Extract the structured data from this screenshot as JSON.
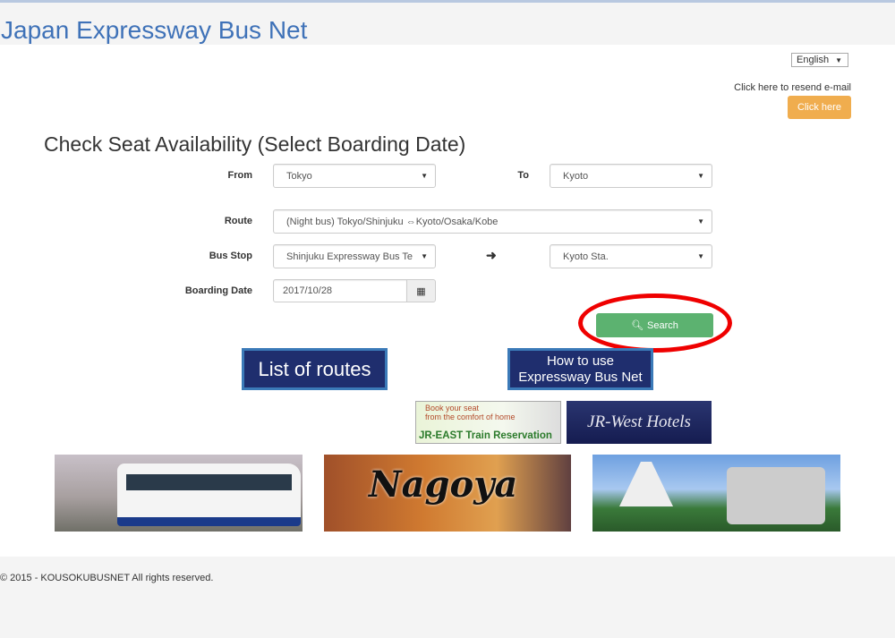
{
  "header": {
    "title": "Japan Expressway Bus Net"
  },
  "language": {
    "selected": "English"
  },
  "resend": {
    "text": "Click here to resend e-mail",
    "button": "Click here"
  },
  "form": {
    "heading": "Check Seat Availability (Select Boarding Date)",
    "from_label": "From",
    "from_value": "Tokyo",
    "to_label": "To",
    "to_value": "Kyoto",
    "route_label": "Route",
    "route_value": "(Night bus) Tokyo/Shinjuku ⇔Kyoto/Osaka/Kobe",
    "busstop_label": "Bus Stop",
    "busstop_from": "Shinjuku Expressway Bus Te",
    "busstop_to": "Kyoto Sta.",
    "date_label": "Boarding Date",
    "date_value": "2017/10/28",
    "search_label": "Search"
  },
  "banners": {
    "routes": "List of routes",
    "howto_line1": "How to use",
    "howto_line2": "Expressway Bus Net",
    "jreast_top1": "Book your seat",
    "jreast_top2": "from the comfort of home",
    "jreast_bottom": "JR-EAST Train Reservation",
    "jrwest": "JR-West Hotels",
    "nagoya": "Nagoya"
  },
  "footer": {
    "copyright": "© 2015 - KOUSOKUBUSNET All rights reserved."
  },
  "colors": {
    "title": "#3f72b8",
    "search": "#5cb270",
    "clickhere": "#f0ad4e",
    "highlight": "#ef0000"
  }
}
